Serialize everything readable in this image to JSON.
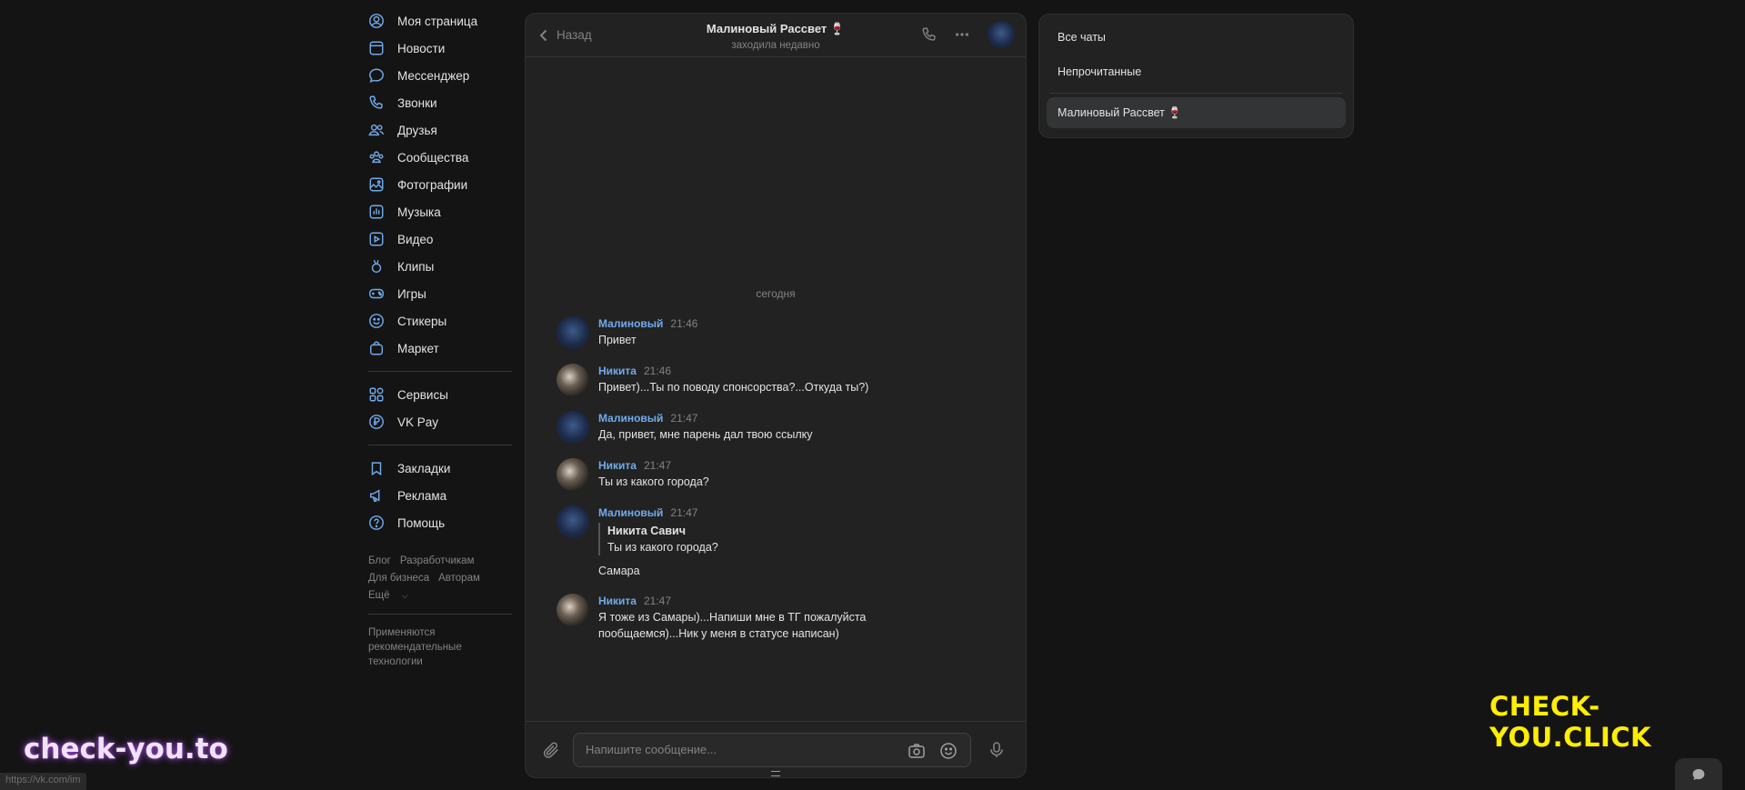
{
  "nav": {
    "items": [
      {
        "label": "Моя страница",
        "icon": "user-circle-icon"
      },
      {
        "label": "Новости",
        "icon": "news-icon"
      },
      {
        "label": "Мессенджер",
        "icon": "message-icon"
      },
      {
        "label": "Звонки",
        "icon": "phone-icon"
      },
      {
        "label": "Друзья",
        "icon": "friends-icon"
      },
      {
        "label": "Сообщества",
        "icon": "communities-icon"
      },
      {
        "label": "Фотографии",
        "icon": "photo-icon"
      },
      {
        "label": "Музыка",
        "icon": "music-icon"
      },
      {
        "label": "Видео",
        "icon": "video-icon"
      },
      {
        "label": "Клипы",
        "icon": "clips-icon"
      },
      {
        "label": "Игры",
        "icon": "gamepad-icon"
      },
      {
        "label": "Стикеры",
        "icon": "smile-icon"
      },
      {
        "label": "Маркет",
        "icon": "bag-icon"
      }
    ],
    "items2": [
      {
        "label": "Сервисы",
        "icon": "grid-icon"
      },
      {
        "label": "VK Pay",
        "icon": "ruble-icon"
      }
    ],
    "items3": [
      {
        "label": "Закладки",
        "icon": "bookmark-icon"
      },
      {
        "label": "Реклама",
        "icon": "megaphone-icon"
      },
      {
        "label": "Помощь",
        "icon": "help-icon"
      }
    ],
    "footer": {
      "links": [
        "Блог",
        "Разработчикам",
        "Для бизнеса",
        "Авторам",
        "Ещё"
      ],
      "note": "Применяются рекомендательные технологии"
    }
  },
  "chat": {
    "back_label": "Назад",
    "peer_name": "Малиновый Рассвет 🍷",
    "peer_status": "заходила недавно",
    "date_separator": "сегодня",
    "messages": [
      {
        "author": "Малиновый",
        "time": "21:46",
        "text": "Привет"
      },
      {
        "author": "Никита",
        "time": "21:46",
        "text": "Привет)...Ты по поводу спонсорства?...Откуда ты?)"
      },
      {
        "author": "Малиновый",
        "time": "21:47",
        "text": "Да, привет, мне парень дал твою ссылку"
      },
      {
        "author": "Никита",
        "time": "21:47",
        "text": "Ты из какого города?"
      },
      {
        "author": "Малиновый",
        "time": "21:47",
        "reply_author": "Никита Савич",
        "reply_text": "Ты из какого города?",
        "text": "Самара"
      },
      {
        "author": "Никита",
        "time": "21:47",
        "text_line1": "Я тоже из Самары)...Напиши мне в ТГ пожалуйста",
        "text_line2": "пообщаемся)...Ник у меня в статусе написан)"
      }
    ],
    "composer_placeholder": "Напишите сообщение..."
  },
  "filters": {
    "all": "Все чаты",
    "unread": "Непрочитанные",
    "folder": "Малиновый Рассвет 🍷"
  },
  "watermarks": {
    "right": "CHECK-YOU.CLICK",
    "left": "check-you.to"
  },
  "status_url": "https://vk.com/im",
  "colors": {
    "accent": "#71aaeb",
    "background": "#141414",
    "panel": "#222222",
    "watermark_yellow": "#ffee00"
  }
}
